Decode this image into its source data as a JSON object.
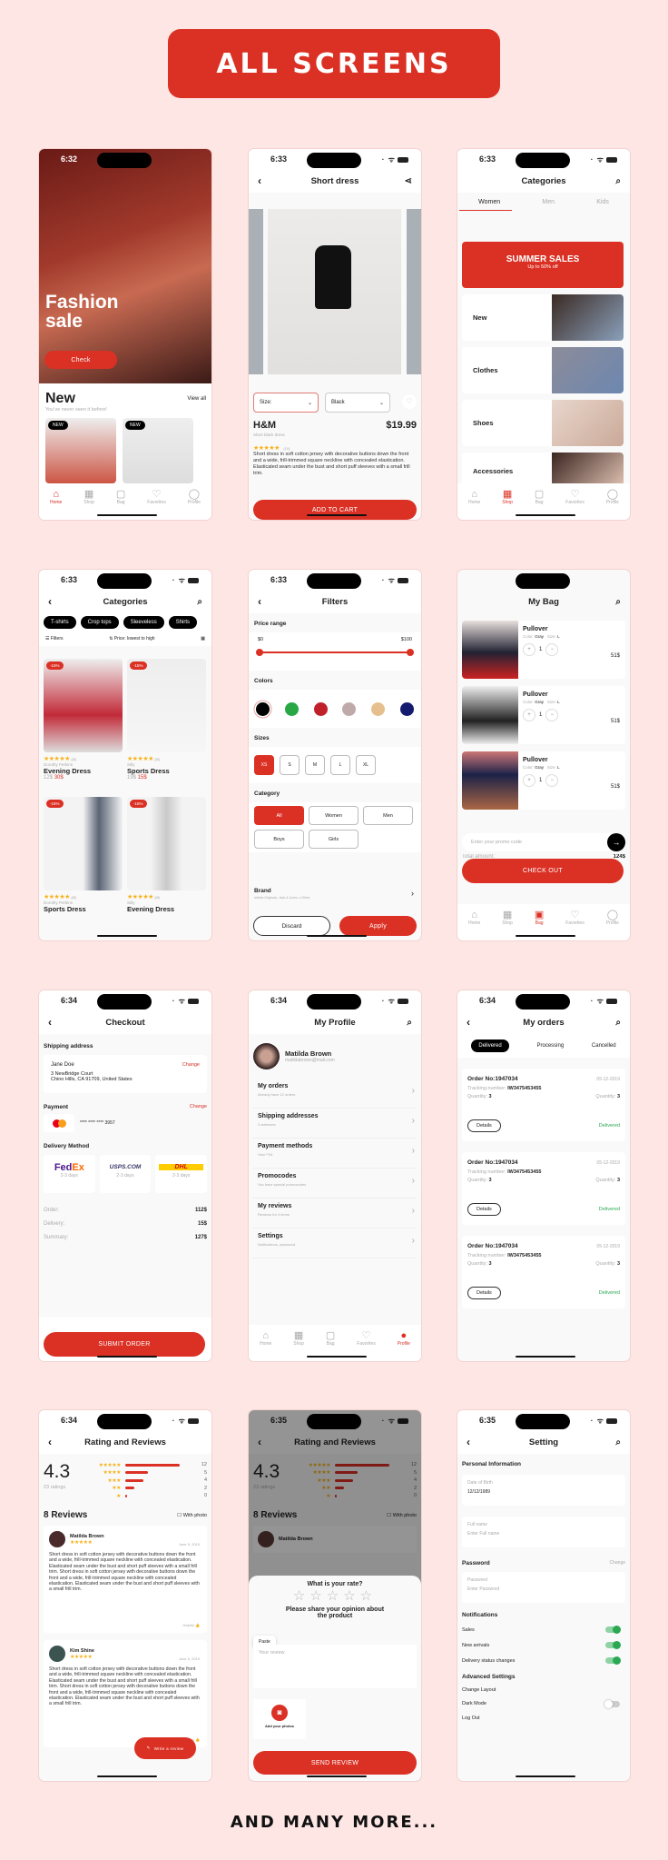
{
  "banner": "ALL SCREENS",
  "footer": "AND MANY MORE...",
  "tabbar": [
    {
      "icon": "home-icon",
      "glyph": "⌂",
      "label": "Home"
    },
    {
      "icon": "shop-icon",
      "glyph": "▦",
      "label": "Shop"
    },
    {
      "icon": "bag-icon",
      "glyph": "▢",
      "label": "Bag"
    },
    {
      "icon": "heart-icon",
      "glyph": "♡",
      "label": "Favorites"
    },
    {
      "icon": "profile-icon",
      "glyph": "◯",
      "label": "Profile"
    }
  ],
  "home": {
    "time": "6:32",
    "hero_title": "Fashion sale",
    "check": "Check",
    "section": "New",
    "subtitle": "You've never seen it before!",
    "view_all": "View all",
    "badge": "NEW"
  },
  "product": {
    "time": "6:33",
    "title": "Short dress",
    "size": "Size:",
    "color": "Black",
    "brand": "H&M",
    "price": "$19.99",
    "name": "Short black dress",
    "reviews": "(10)",
    "desc": "Short dress in soft cotton jersey with decorative buttons down the front and a wide, frill-trimmed square neckline with concealed elastication. Elasticated seam under the bust and short puff sleeves with a small frill trim.",
    "cta": "ADD TO CART"
  },
  "categories": {
    "time": "6:33",
    "title": "Categories",
    "tabs": [
      "Women",
      "Men",
      "Kids"
    ],
    "promo_title": "SUMMER SALES",
    "promo_sub": "Up to 50% off",
    "items": [
      "New",
      "Clothes",
      "Shoes",
      "Accessories"
    ]
  },
  "catalog": {
    "time": "6:33",
    "title": "Categories",
    "chips": [
      "T-shirts",
      "Crop tops",
      "Sleeveless",
      "Shirts"
    ],
    "filters": "Filters",
    "sort": "Price: lowest to high",
    "discount": "-15%",
    "products": [
      {
        "brand": "Dorothy Perkins",
        "name": "Evening Dress",
        "old": "12$",
        "new": "30$"
      },
      {
        "brand": "Sitly",
        "name": "Sports Dress",
        "old": "19$",
        "new": "15$"
      },
      {
        "brand": "Dorothy Perkins",
        "name": "Sports Dress",
        "old": "",
        "new": ""
      },
      {
        "brand": "Sitly",
        "name": "Evening Dress",
        "old": "",
        "new": ""
      }
    ],
    "count": "(10)"
  },
  "filters": {
    "time": "6:33",
    "title": "Filters",
    "price_label": "Price range",
    "min": "$0",
    "max": "$100",
    "range": [
      0,
      100
    ],
    "colors_label": "Colors",
    "colors": [
      "#000000",
      "#27a844",
      "#c0202a",
      "#bfaaa9",
      "#e5c08e",
      "#141a6e"
    ],
    "sizes_label": "Sizes",
    "sizes": [
      "XS",
      "S",
      "M",
      "L",
      "XL"
    ],
    "category_label": "Category",
    "categories": [
      "All",
      "Women",
      "Men",
      "Boys",
      "Girls"
    ],
    "brand_label": "Brand",
    "brand_sub": "adidas Originals, Jack & Jones, s.Oliver",
    "discard": "Discard",
    "apply": "Apply"
  },
  "bag": {
    "title": "My Bag",
    "items": [
      {
        "name": "Pullover",
        "color": "Gray",
        "size": "L",
        "qty": "1",
        "price": "51$"
      },
      {
        "name": "Pullover",
        "color": "Gray",
        "size": "L",
        "qty": "1",
        "price": "51$"
      },
      {
        "name": "Pullover",
        "color": "Gray",
        "size": "L",
        "qty": "1",
        "price": "51$"
      }
    ],
    "color_label": "Color:",
    "size_label": "Size:",
    "promo_placeholder": "Enter your promo code",
    "total_label": "Total amount:",
    "total": "124$",
    "cta": "CHECK OUT"
  },
  "checkout": {
    "time": "6:34",
    "title": "Checkout",
    "shipping": "Shipping address",
    "name": "Jane Doe",
    "change": "Change",
    "addr1": "3 NewBridge Court",
    "addr2": "Chino Hills, CA 91709, United States",
    "payment": "Payment",
    "card": "**** **** **** 3957",
    "delivery": "Delivery Method",
    "carriers": [
      {
        "name": "FedEx",
        "days": "2-3 days"
      },
      {
        "name": "USPS.COM",
        "days": "2-3 days"
      },
      {
        "name": "DHL",
        "days": "2-3 days"
      }
    ],
    "order_label": "Order:",
    "order": "112$",
    "delivery_label": "Delivery:",
    "delivery_fee": "15$",
    "summary_label": "Summary:",
    "summary": "127$",
    "cta": "SUBMIT ORDER"
  },
  "profile": {
    "time": "6:34",
    "title": "My Profile",
    "name": "Matilda Brown",
    "email": "matildabrown@mail.com",
    "items": [
      {
        "title": "My orders",
        "sub": "Already have 12 orders"
      },
      {
        "title": "Shipping addresses",
        "sub": "3 adresses"
      },
      {
        "title": "Payment methods",
        "sub": "Visa **34"
      },
      {
        "title": "Promocodes",
        "sub": "You have special promocodes"
      },
      {
        "title": "My reviews",
        "sub": "Reviews for 4 items"
      },
      {
        "title": "Settings",
        "sub": "Notifications, password"
      }
    ]
  },
  "orders": {
    "time": "6:34",
    "title": "My orders",
    "tabs": [
      "Delivered",
      "Processing",
      "Cancelled"
    ],
    "list": [
      {
        "no": "Order No:1947034",
        "date": "05-12-2019",
        "tracking": "IW3475453455",
        "qty": "3",
        "status": "Delivered"
      },
      {
        "no": "Order No:1947034",
        "date": "05-12-2019",
        "tracking": "IW3475453455",
        "qty": "3",
        "status": "Delivered"
      },
      {
        "no": "Order No:1947034",
        "date": "05-12-2019",
        "tracking": "IW3475453455",
        "qty": "3",
        "status": "Delivered"
      }
    ],
    "tracking_label": "Tracking number:",
    "qty_label": "Quantity:",
    "details": "Details"
  },
  "reviews": {
    "time": "6:34",
    "title": "Rating and Reviews",
    "rating": "4.3",
    "ratings": "23 ratings",
    "dist": [
      {
        "stars": 5,
        "count": 12
      },
      {
        "stars": 4,
        "count": 5
      },
      {
        "stars": 3,
        "count": 4
      },
      {
        "stars": 2,
        "count": 2
      },
      {
        "stars": 1,
        "count": 0
      }
    ],
    "count_label": "8 Reviews",
    "with_photo": "With photo",
    "list": [
      {
        "name": "Matilda Brown",
        "date": "June 5, 2019"
      },
      {
        "name": "Kim Shine",
        "date": "June 5, 2019"
      }
    ],
    "body": "Short dress in soft cotton jersey with decorative buttons down the front and a wide, frill-trimmed square neckline with concealed elastication. Elasticated seam under the bust and short puff sleeves with a small frill trim. Short dress in soft cotton jersey with decorative buttons down the front and a wide, frill-trimmed square neckline with concealed elastication. Elasticated seam under the bust and short puff sleeves with a small frill trim.",
    "helpful": "Helpful",
    "write": "Write a review"
  },
  "rate": {
    "time": "6:35",
    "question": "What is your rate?",
    "prompt": "Please share your opinion about the product",
    "paste": "Paste",
    "placeholder": "Your review",
    "add_photos": "Add your photos",
    "cta": "SEND REVIEW"
  },
  "settings": {
    "time": "6:35",
    "title": "Setting",
    "personal": "Personal Information",
    "dob_label": "Date of Birth",
    "dob": "12/12/1989",
    "name_label": "Full name",
    "name_placeholder": "Enter Full name",
    "password": "Password",
    "change": "Change",
    "pw_label": "Password",
    "pw_placeholder": "Enter Password",
    "notifications": "Notifications",
    "toggles": [
      {
        "label": "Sales",
        "on": true
      },
      {
        "label": "New arrivals",
        "on": true
      },
      {
        "label": "Delivery status changes",
        "on": true
      }
    ],
    "advanced": "Advanced Settings",
    "layout": "Change Layout",
    "dark": "Dark Mode",
    "dark_on": false,
    "logout": "Log Out"
  }
}
